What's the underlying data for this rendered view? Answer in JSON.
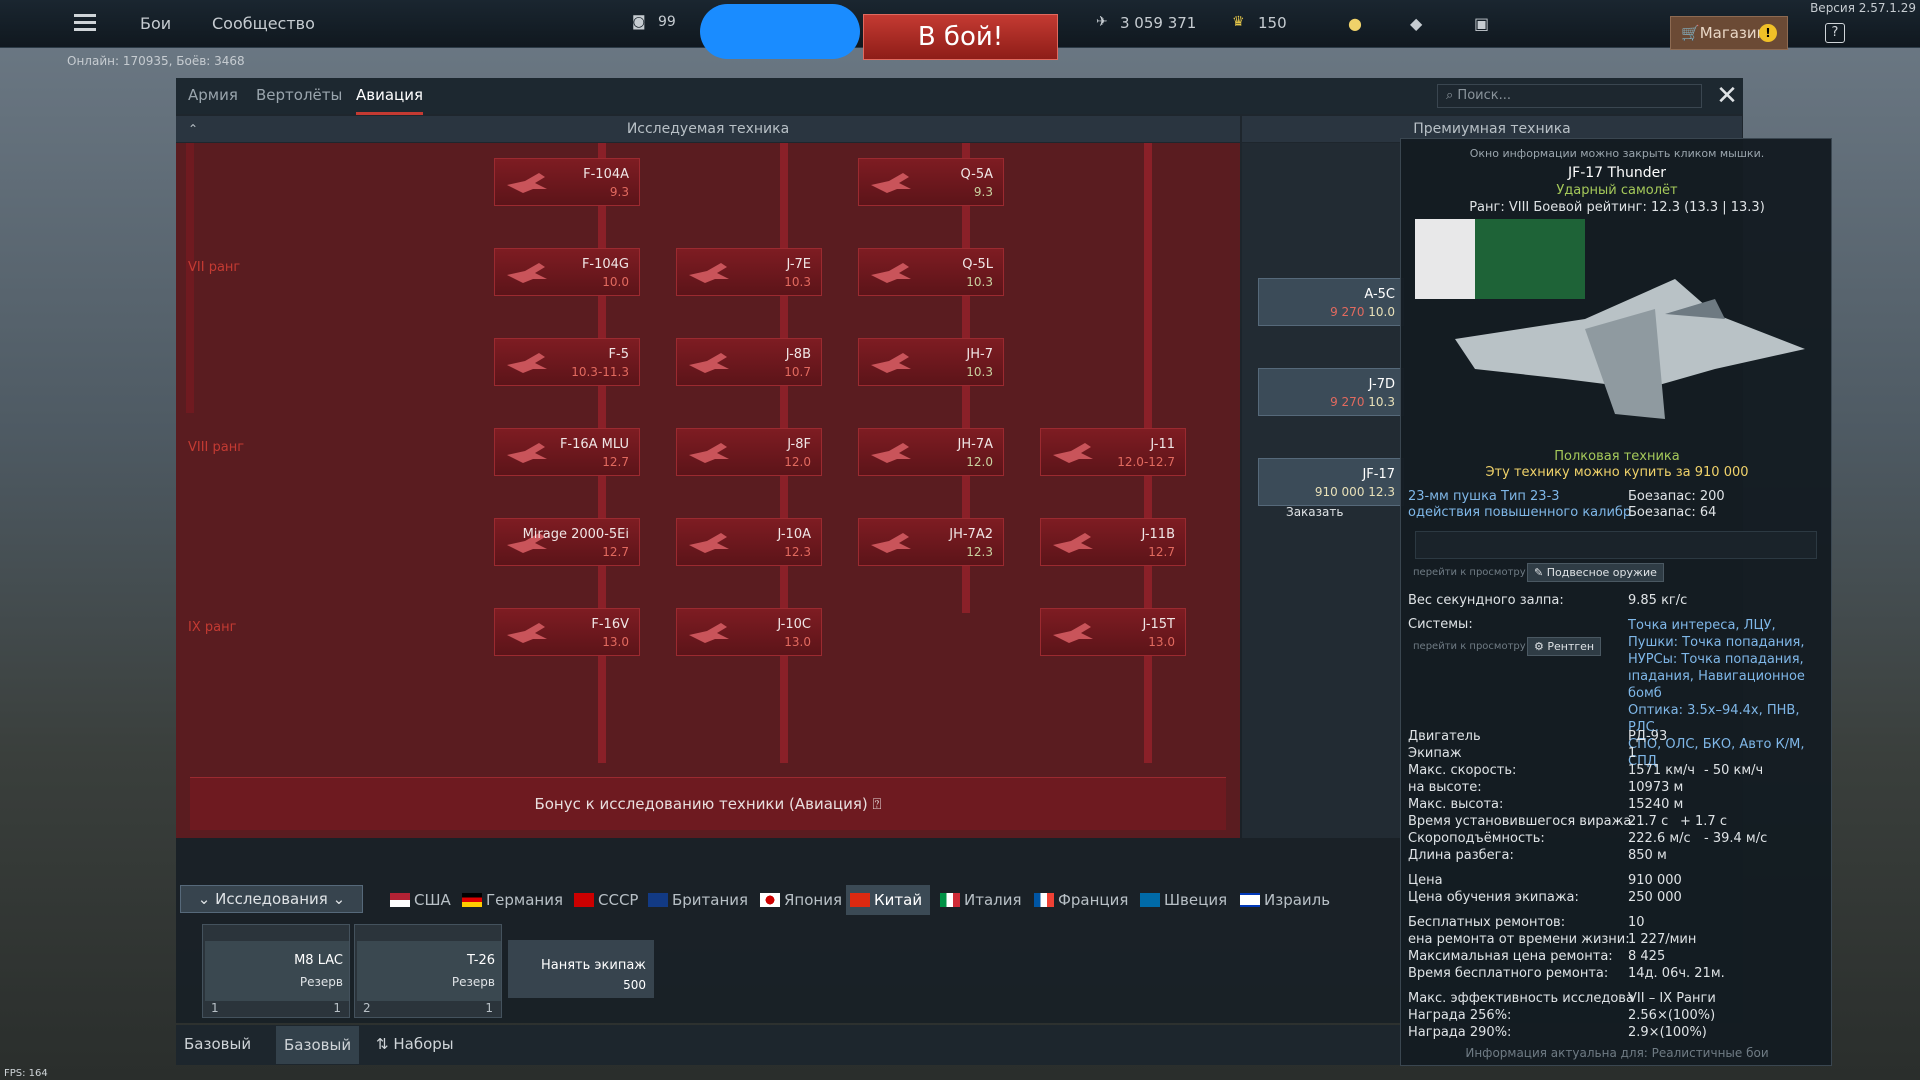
{
  "version": "Версия 2.57.1.29",
  "online": "Онлайн: 170935, Боёв: 3468",
  "fps": "FPS: 164",
  "topbar": {
    "battles": "Бои",
    "community": "Сообщество",
    "level": "99",
    "battle_button": "В бой!",
    "silver": "3 059 371",
    "gold": "150",
    "shop": "Магазин"
  },
  "tabs": [
    "Армия",
    "Вертолёты",
    "Авиация"
  ],
  "search_placeholder": "Поиск...",
  "section_research": "Исследуемая техника",
  "section_premium": "Премиумная техника",
  "ranks": [
    "VII ранг",
    "VIII ранг",
    "IX ранг"
  ],
  "vehicles": [
    {
      "name": "F-104A",
      "br": "9.3"
    },
    {
      "name": "Q-5A",
      "br": "9.3"
    },
    {
      "name": "F-104G",
      "br": "10.0"
    },
    {
      "name": "J-7E",
      "br": "10.3"
    },
    {
      "name": "Q-5L",
      "br": "10.3"
    },
    {
      "name": "F-5",
      "br": "10.3-11.3"
    },
    {
      "name": "J-8B",
      "br": "10.7"
    },
    {
      "name": "JH-7",
      "br": "10.3"
    },
    {
      "name": "F-16A MLU",
      "br": "12.7"
    },
    {
      "name": "J-8F",
      "br": "12.0"
    },
    {
      "name": "JH-7A",
      "br": "12.0"
    },
    {
      "name": "J-11",
      "br": "12.0-12.7"
    },
    {
      "name": "Mirage 2000-5Ei",
      "br": "12.7"
    },
    {
      "name": "J-10A",
      "br": "12.3"
    },
    {
      "name": "JH-7A2",
      "br": "12.3"
    },
    {
      "name": "J-11B",
      "br": "12.7"
    },
    {
      "name": "F-16V",
      "br": "13.0"
    },
    {
      "name": "J-10C",
      "br": "13.0"
    },
    {
      "name": "J-15T",
      "br": "13.0"
    }
  ],
  "premium": [
    {
      "name": "A-5C",
      "price": "9 270",
      "br": "10.0"
    },
    {
      "name": "J-7D",
      "price": "9 270",
      "br": "10.3"
    },
    {
      "name": "JF-17",
      "price": "910 000",
      "br": "12.3",
      "action": "Заказать"
    }
  ],
  "bonus": "Бонус к исследованию техники (Авиация)",
  "research_button": "Исследования",
  "nations": [
    "США",
    "Германия",
    "СССР",
    "Британия",
    "Япония",
    "Китай",
    "Италия",
    "Франция",
    "Швеция",
    "Израиль"
  ],
  "crew_slots": [
    {
      "name": "M8 LAC",
      "status": "Резерв",
      "crew": "1",
      "num": "1"
    },
    {
      "name": "T-26",
      "status": "Резерв",
      "crew": "2",
      "num": "1"
    }
  ],
  "hire_crew": {
    "label": "Нанять экипаж",
    "price": "500"
  },
  "bottom": [
    "Базовый",
    "Базовый",
    "Наборы"
  ],
  "tooltip": {
    "hint": "Окно информации можно закрыть кликом мышки.",
    "title": "JF-17 Thunder",
    "type": "Ударный самолёт",
    "rank_line": "Ранг: VIII  Боевой рейтинг: 12.3 (13.3 | 13.3)",
    "regiment": "Полковая техника",
    "buy": "Эту технику можно купить за 910 000",
    "weapon1": "23-мм пушка Тип 23-3",
    "weapon2": "одействия повышенного калибр",
    "ammo1": "Боезапас: 200",
    "ammo2": "Боезапас: 64",
    "view_link": "перейти к просмотру",
    "suspended": "Подвесное оружие",
    "salvo_k": "Вес секундного залпа:",
    "salvo_v": "9.85 кг/с",
    "systems_k": "Системы:",
    "systems_v": [
      "Точка интереса, ЛЦУ,",
      "Пушки:  Точка попадания,",
      "НУРСы:  Точка попадания,",
      "ıпадания, Навигационное бомб",
      "Оптика: 3.5x–94.4x, ПНВ, РЛС,",
      "СПО, ОЛС, БКО, Авто К/М, СПД"
    ],
    "xray": "Рентген",
    "stats": [
      {
        "k": "Двигатель",
        "v": "РД-93"
      },
      {
        "k": "Экипаж",
        "v": "1"
      },
      {
        "k": "Макс. скорость:",
        "v": "1571 км/ч",
        "d": "- 50 км/ч"
      },
      {
        "k": "на высоте:",
        "v": "10973 м"
      },
      {
        "k": "Макс. высота:",
        "v": "15240 м"
      },
      {
        "k": "Время установившегося виража",
        "v": "21.7 с",
        "d": "+ 1.7 с"
      },
      {
        "k": "Скороподъёмность:",
        "v": "222.6 м/с",
        "d": "- 39.4 м/с"
      },
      {
        "k": "Длина разбега:",
        "v": "850 м"
      }
    ],
    "costs": [
      {
        "k": "Цена",
        "v": "910 000"
      },
      {
        "k": "Цена обучения экипажа:",
        "v": "250 000"
      }
    ],
    "repair": [
      {
        "k": "Бесплатных ремонтов:",
        "v": "10"
      },
      {
        "k": "ена ремонта от времени жизни:",
        "v": "1 227/мин"
      },
      {
        "k": "Максимальная цена ремонта:",
        "v": "8 425"
      },
      {
        "k": "Время бесплатного ремонта:",
        "v": "14д. 06ч. 21м."
      }
    ],
    "research": [
      {
        "k": "Макс. эффективность исследова",
        "v": "VII – IX Ранги"
      },
      {
        "k": "Награда 256%:",
        "v": "2.56×(100%)"
      },
      {
        "k": "Награда 290%:",
        "v": "2.9×(100%)"
      }
    ],
    "footer": "Информация актуальна для: Реалистичные бои"
  }
}
